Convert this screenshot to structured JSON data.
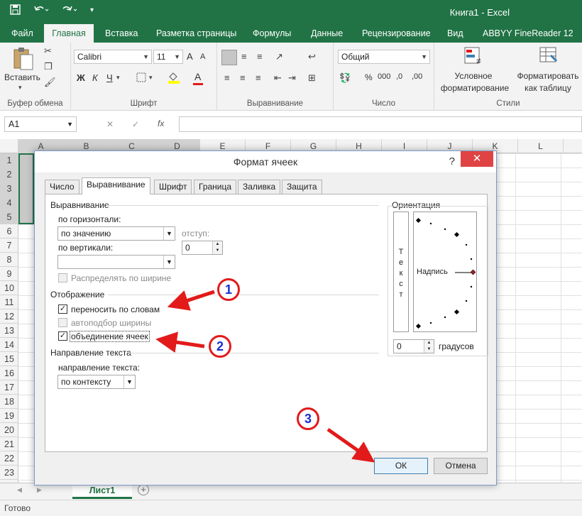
{
  "window": {
    "title": "Книга1 - Excel",
    "undo_icon": "undo-icon",
    "redo_icon": "redo-icon"
  },
  "tabs": [
    "Файл",
    "Главная",
    "Вставка",
    "Разметка страницы",
    "Формулы",
    "Данные",
    "Рецензирование",
    "Вид",
    "ABBYY FineReader 12"
  ],
  "ribbon": {
    "clipboard": {
      "paste_label": "Вставить",
      "group_label": "Буфер обмена"
    },
    "font": {
      "name": "Calibri",
      "size": "11",
      "bold": "Ж",
      "italic": "К",
      "underline": "Ч",
      "grow": "A",
      "shrink": "A",
      "font_color_letter": "A",
      "group_label": "Шрифт"
    },
    "alignment": {
      "group_label": "Выравнивание"
    },
    "number": {
      "format": "Общий",
      "percent": "%",
      "comma": "000",
      "inc_dec": ",0",
      "dec_dec": ",00",
      "group_label": "Число"
    },
    "styles": {
      "cond_format_line1": "Условное",
      "cond_format_line2": "форматирование",
      "format_table_line1": "Форматировать",
      "format_table_line2": "как таблицу",
      "group_label": "Стили"
    }
  },
  "formula_bar": {
    "name_box": "A1",
    "cancel": "✕",
    "enter": "✓",
    "fx": "fx"
  },
  "grid": {
    "columns": [
      "A",
      "B",
      "C",
      "D",
      "E",
      "F",
      "G",
      "H",
      "I",
      "J",
      "K",
      "L"
    ],
    "rows": [
      "1",
      "2",
      "3",
      "4",
      "5",
      "6",
      "7",
      "8",
      "9",
      "10",
      "11",
      "12",
      "13",
      "14",
      "15",
      "16",
      "17",
      "18",
      "19",
      "20",
      "21",
      "22",
      "23"
    ]
  },
  "sheet_tab": "Лист1",
  "add_sheet": "+",
  "status": "Готово",
  "dialog": {
    "title": "Формат ячеек",
    "help": "?",
    "close": "✕",
    "tabs": [
      "Число",
      "Выравнивание",
      "Шрифт",
      "Граница",
      "Заливка",
      "Защита"
    ],
    "alignment_section": "Выравнивание",
    "horizontal_label": "по горизонтали:",
    "horizontal_value": "по значению",
    "indent_label": "отступ:",
    "indent_value": "0",
    "vertical_label": "по вертикали:",
    "vertical_value": "",
    "distribute_label": "Распределять по ширине",
    "display_section": "Отображение",
    "wrap_label": "переносить по словам",
    "wrap_checked": true,
    "shrink_label": "автоподбор ширины",
    "merge_label": "объединение ячеек",
    "merge_checked": true,
    "direction_section": "Направление текста",
    "direction_label": "направление текста:",
    "direction_value": "по контексту",
    "orientation_section": "Ориентация",
    "orientation_vertical_text": [
      "Т",
      "е",
      "к",
      "с",
      "т"
    ],
    "orientation_inscription": "Надпись",
    "degrees_value": "0",
    "degrees_label": "градусов",
    "ok": "ОК",
    "cancel": "Отмена"
  },
  "annotations": [
    "1",
    "2",
    "3"
  ],
  "colors": {
    "excel_green": "#217346",
    "close_red": "#e04343",
    "annotation_red": "#e21a1a",
    "annotation_blue": "#1a2ed1",
    "selection_gray": "#c8c8c8"
  }
}
